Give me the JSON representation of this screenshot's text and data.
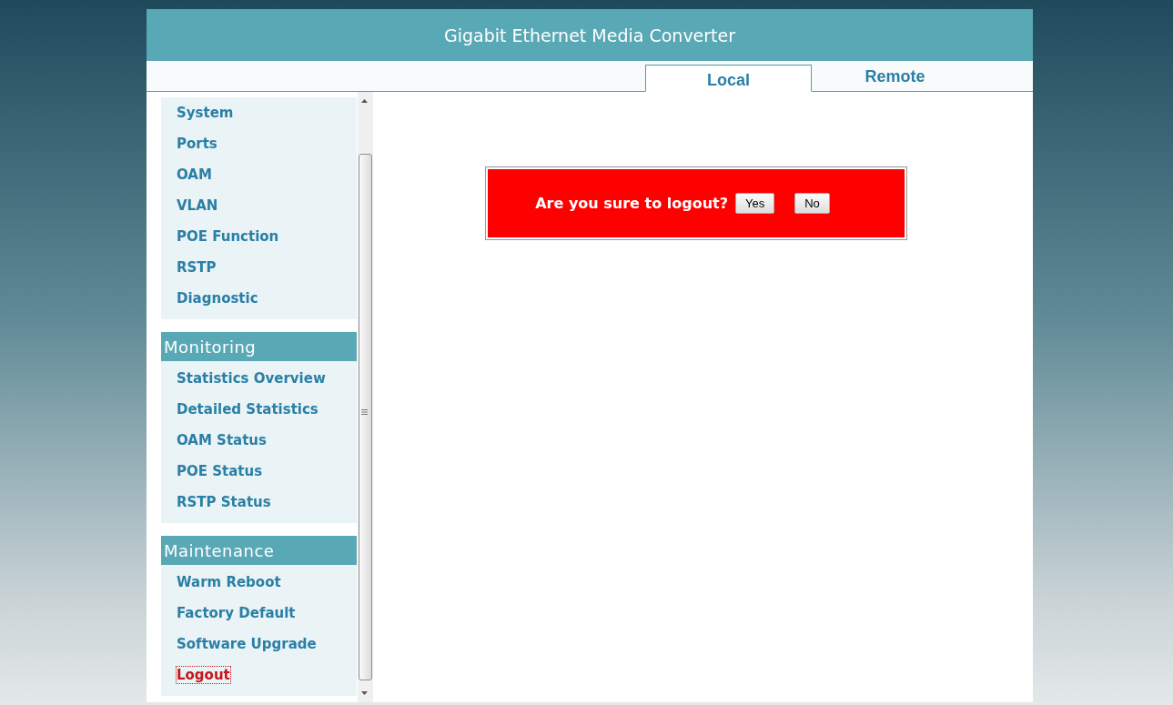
{
  "header": {
    "title": "Gigabit Ethernet Media Converter"
  },
  "tabs": [
    {
      "label": "Local",
      "selected": true
    },
    {
      "label": "Remote",
      "selected": false
    }
  ],
  "sidebar": {
    "sections": [
      {
        "items": [
          {
            "label": "System",
            "selected": false
          },
          {
            "label": "Ports",
            "selected": false
          },
          {
            "label": "OAM",
            "selected": false
          },
          {
            "label": "VLAN",
            "selected": false
          },
          {
            "label": "POE Function",
            "selected": false
          },
          {
            "label": "RSTP",
            "selected": false
          },
          {
            "label": "Diagnostic",
            "selected": false
          }
        ]
      },
      {
        "title": "Monitoring",
        "items": [
          {
            "label": "Statistics Overview",
            "selected": false
          },
          {
            "label": "Detailed Statistics",
            "selected": false
          },
          {
            "label": "OAM Status",
            "selected": false
          },
          {
            "label": "POE Status",
            "selected": false
          },
          {
            "label": "RSTP Status",
            "selected": false
          }
        ]
      },
      {
        "title": "Maintenance",
        "items": [
          {
            "label": "Warm Reboot",
            "selected": false
          },
          {
            "label": "Factory Default",
            "selected": false
          },
          {
            "label": "Software Upgrade",
            "selected": false
          },
          {
            "label": "Logout",
            "selected": true
          }
        ]
      }
    ]
  },
  "dialog": {
    "message": "Are you sure to logout?",
    "buttons": [
      "Yes",
      "No"
    ]
  }
}
